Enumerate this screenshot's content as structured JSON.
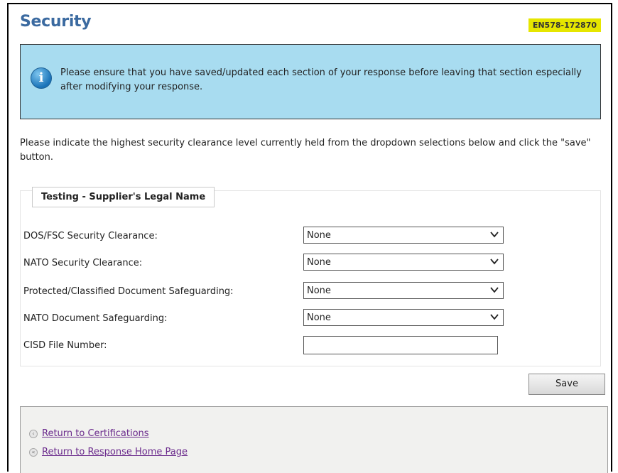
{
  "header": {
    "title": "Security",
    "reference": "EN578-172870"
  },
  "info": {
    "icon": "info-icon",
    "message": "Please ensure that you have saved/updated each section of your response before leaving that section especially after modifying your response."
  },
  "instructions": "Please indicate the highest security clearance level currently held from the dropdown selections below and click the \"save\" button.",
  "section": {
    "title": "Testing - Supplier's Legal Name",
    "fields": [
      {
        "label": "DOS/FSC Security Clearance:",
        "type": "select",
        "value": "None"
      },
      {
        "label": "NATO Security Clearance:",
        "type": "select",
        "value": "None"
      },
      {
        "label": "Protected/Classified Document Safeguarding:",
        "type": "select",
        "value": "None"
      },
      {
        "label": "NATO Document Safeguarding:",
        "type": "select",
        "value": "None"
      },
      {
        "label": "CISD File Number:",
        "type": "text",
        "value": ""
      }
    ]
  },
  "actions": {
    "save_label": "Save"
  },
  "links": [
    {
      "label": "Return to Certifications",
      "icon": "single-back-icon"
    },
    {
      "label": "Return to Response Home Page",
      "icon": "double-back-icon"
    }
  ],
  "colors": {
    "title": "#3b6aa0",
    "badge_bg": "#e6e600",
    "info_bg": "#a8dcf0",
    "link": "#6a2a8c"
  }
}
